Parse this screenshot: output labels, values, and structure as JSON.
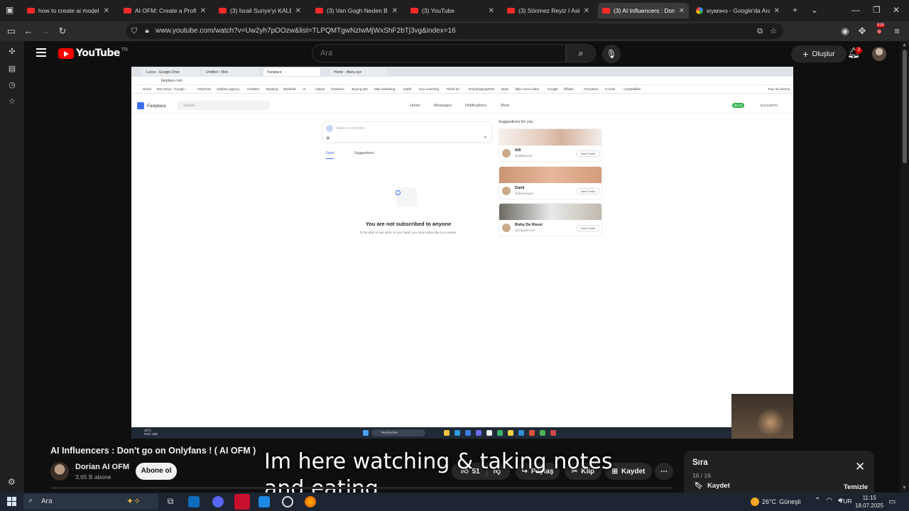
{
  "browser": {
    "tabs": [
      {
        "title": "how to create ai models fo",
        "active": false,
        "favicon": "youtube-favicon"
      },
      {
        "title": "AI OFM: Create a Profitable",
        "active": false,
        "favicon": "youtube-favicon"
      },
      {
        "title": "(3) İsrail Suriye'yi KALBİNDE",
        "active": false,
        "favicon": "youtube-favicon"
      },
      {
        "title": "(3) Van Gogh Neden Bu Ka",
        "active": false,
        "favicon": "youtube-favicon"
      },
      {
        "title": "(3) YouTube",
        "active": false,
        "favicon": "youtube-favicon"
      },
      {
        "title": "(3) Sönmez Reyiz I Askerlik",
        "active": false,
        "favicon": "youtube-favicon"
      },
      {
        "title": "(3) AI Influencers : Don't",
        "active": true,
        "favicon": "youtube-favicon"
      },
      {
        "title": "юумэнэ - Google'da Ara",
        "active": false,
        "favicon": "google-favicon"
      }
    ],
    "url": "www.youtube.com/watch?v=Uw2yh7pOOzw&list=TLPQMTgwNzIwMjWxShF2bTj3vg&index=16",
    "profile_badge": "835"
  },
  "youtube": {
    "logo_text": "YouTube",
    "region": "TR",
    "search_placeholder": "Ara",
    "create_label": "Oluştur",
    "notification_count": "3"
  },
  "player": {
    "inner_tabs": [
      "Lucca - Google Drive",
      "Untitled - Miro",
      "Fanplace",
      "Home - dfans.xyz"
    ],
    "inner_url": "fanplace.com",
    "bookmarks": [
      "Gmail",
      "Mon Drive - Google...",
      "OnlyFans",
      "onlyfans agency",
      "Chatters",
      "Banking",
      "Blackhat",
      "AI",
      "tokkon",
      "freelance",
      "Buying ads",
      "Mail marketing",
      "reddit",
      "reco coaching",
      "Tiktok biz",
      "Dropshipping2024",
      "tasks",
      "fake convo video",
      "Google",
      "Affiliate",
      "Formation",
      "AI tools",
      "comptabilité",
      "Tous les favoris"
    ],
    "site_name": "Fanplace",
    "site_search": "Search...",
    "nav": [
      "Home",
      "Messages",
      "Notifications",
      "More"
    ],
    "user_handle": "fp12345678",
    "user_balance": "$0.00",
    "composer_placeholder": "Make a new post...",
    "feed_tabs": [
      "Feed",
      "Suggestions"
    ],
    "empty_title": "You are not subscribed to anyone",
    "empty_subtitle": "To be able to see items in your feed, you must subscribe to a creator.",
    "suggestions_title": "Suggestions for you",
    "suggestions": [
      {
        "name": "Alli",
        "handle": "@allibarnett",
        "button": "View Profile"
      },
      {
        "name": "Danii",
        "handle": "@daniivegas",
        "button": "View Profile"
      },
      {
        "name": "Ruby De Rossi",
        "handle": "@rubyderossi",
        "button": "View Profile"
      }
    ],
    "win_weather": "29°C",
    "win_weather_desc": "Rain stall",
    "win_search": "Rechercher"
  },
  "video": {
    "title": "AI Influencers : Don't go on Onlyfans ! ( AI OFM )",
    "channel": "Dorian AI OFM",
    "subscribers": "3,65 B abone",
    "subscribe_label": "Abone ol",
    "likes": "51",
    "share_label": "Paylaş",
    "clip_label": "Klip",
    "save_label": "Kaydet",
    "overlay_text": "Im here watching & taking notes and eating"
  },
  "queue": {
    "title": "Sıra",
    "position": "16 / 16",
    "save_label": "Kaydet",
    "clear_label": "Temizle"
  },
  "taskbar": {
    "search_placeholder": "Ara",
    "weather_temp": "26°C",
    "weather_desc": "Güneşli",
    "language": "TUR",
    "time": "11:15",
    "date": "18.07.2025"
  }
}
